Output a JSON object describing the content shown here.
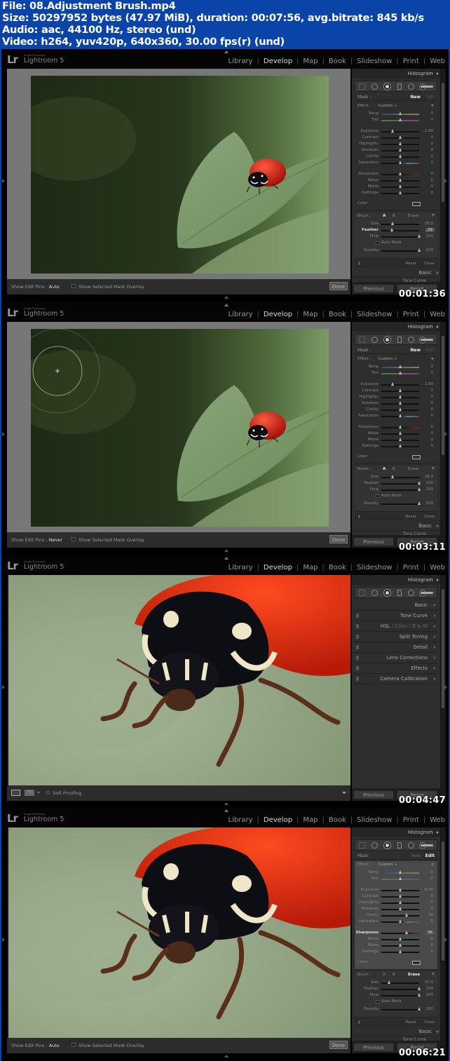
{
  "file_info": {
    "line1": "File: 08.Adjustment Brush.mp4",
    "line2": "Size: 50297952 bytes (47.97 MiB), duration: 00:07:56, avg.bitrate: 845 kb/s",
    "line3": "Audio: aac, 44100 Hz, stereo (und)",
    "line4": "Video: h264, yuv420p, 640x360, 30.00 fps(r) (und)"
  },
  "app": {
    "logo": "Lr",
    "adobe_label": "Adobe Photoshop",
    "name": "Lightroom 5",
    "modules": [
      "Library",
      "Develop",
      "Map",
      "Book",
      "Slideshow",
      "Print",
      "Web"
    ],
    "active_module": "Develop"
  },
  "panel_labels": {
    "histogram": "Histogram",
    "mask": "Mask :",
    "new": "New",
    "edit": "Edit",
    "effect": "Effect :",
    "effect_value": "Custom ÷",
    "color": "Color",
    "brush": "Brush :",
    "brush_a": "A",
    "brush_b": "B",
    "erase": "Erase",
    "auto_mask": "Auto Mask",
    "reset": "Reset",
    "close": "Close",
    "basic": "Basic",
    "tone_curve": "Tone Curve",
    "previous": "Previous",
    "reset_button": "Reset",
    "done": "Done",
    "show_edit_pins": "Show Edit Pins :",
    "show_mask_overlay": "Show Selected Mask Overlay",
    "soft_proofing": "Soft Proofing"
  },
  "frames": [
    {
      "timestamp": "00:01:36",
      "show_edit_pins": "Auto",
      "mask_state": "new",
      "sliders": [
        {
          "label": "Temp",
          "value": "0",
          "pos": 0.5,
          "track": "temp"
        },
        {
          "label": "Tint",
          "value": "0",
          "pos": 0.5,
          "track": "tint"
        },
        {
          "label": "Exposure",
          "value": "- 1.89",
          "pos": 0.3
        },
        {
          "label": "Contrast",
          "value": "0",
          "pos": 0.5
        },
        {
          "label": "Highlights",
          "value": "0",
          "pos": 0.5
        },
        {
          "label": "Shadows",
          "value": "0",
          "pos": 0.5
        },
        {
          "label": "Clarity",
          "value": "0",
          "pos": 0.5
        },
        {
          "label": "Saturation",
          "value": "0",
          "pos": 0.5,
          "track": "sat"
        },
        {
          "label": "Sharpness",
          "value": "0",
          "pos": 0.5,
          "track": "sharp"
        },
        {
          "label": "Noise",
          "value": "0",
          "pos": 0.5
        },
        {
          "label": "Moiré",
          "value": "0",
          "pos": 0.5
        },
        {
          "label": "Defringe",
          "value": "0",
          "pos": 0.5
        }
      ],
      "brush": [
        {
          "label": "Size",
          "value": "28.0",
          "pos": 0.3
        },
        {
          "label": "Feather",
          "value": "29",
          "pos": 0.29,
          "active": true
        },
        {
          "label": "Flow",
          "value": "100",
          "pos": 1.0
        },
        {
          "label": "Density",
          "value": "100",
          "pos": 1.0
        }
      ]
    },
    {
      "timestamp": "00:03:11",
      "show_edit_pins": "Never",
      "mask_state": "new",
      "sliders": [
        {
          "label": "Temp",
          "value": "0",
          "pos": 0.5,
          "track": "temp"
        },
        {
          "label": "Tint",
          "value": "0",
          "pos": 0.5,
          "track": "tint"
        },
        {
          "label": "Exposure",
          "value": "- 1.89",
          "pos": 0.3
        },
        {
          "label": "Contrast",
          "value": "0",
          "pos": 0.5
        },
        {
          "label": "Highlights",
          "value": "0",
          "pos": 0.5
        },
        {
          "label": "Shadows",
          "value": "0",
          "pos": 0.5
        },
        {
          "label": "Clarity",
          "value": "0",
          "pos": 0.5
        },
        {
          "label": "Saturation",
          "value": "0",
          "pos": 0.5,
          "track": "sat"
        },
        {
          "label": "Sharpness",
          "value": "0",
          "pos": 0.5,
          "track": "sharp"
        },
        {
          "label": "Noise",
          "value": "0",
          "pos": 0.5
        },
        {
          "label": "Moiré",
          "value": "0",
          "pos": 0.5
        },
        {
          "label": "Defringe",
          "value": "0",
          "pos": 0.5
        }
      ],
      "brush": [
        {
          "label": "Size",
          "value": "28.0",
          "pos": 0.3
        },
        {
          "label": "Feather",
          "value": "100",
          "pos": 1.0
        },
        {
          "label": "Flow",
          "value": "100",
          "pos": 1.0
        },
        {
          "label": "Density",
          "value": "100",
          "pos": 1.0
        }
      ]
    },
    {
      "timestamp": "00:04:47",
      "sections": [
        {
          "label": "Basic",
          "switch": false
        },
        {
          "label": "Tone Curve",
          "switch": true
        },
        {
          "label": "HSL / Color / B & W",
          "switch": true
        },
        {
          "label": "Split Toning",
          "switch": true
        },
        {
          "label": "Detail",
          "switch": true
        },
        {
          "label": "Lens Corrections",
          "switch": true
        },
        {
          "label": "Effects",
          "switch": true
        },
        {
          "label": "Camera Calibration",
          "switch": true
        }
      ],
      "hsl_parts": [
        "HSL",
        "Color",
        "B & W"
      ]
    },
    {
      "timestamp": "00:06:21",
      "show_edit_pins": "Auto",
      "mask_state": "edit",
      "sliders": [
        {
          "label": "Temp",
          "value": "0",
          "pos": 0.5,
          "track": "temp"
        },
        {
          "label": "Tint",
          "value": "0",
          "pos": 0.5,
          "track": "tint"
        },
        {
          "label": "Exposure",
          "value": "0.00",
          "pos": 0.5
        },
        {
          "label": "Contrast",
          "value": "0",
          "pos": 0.5
        },
        {
          "label": "Highlights",
          "value": "0",
          "pos": 0.5
        },
        {
          "label": "Shadows",
          "value": "0",
          "pos": 0.5
        },
        {
          "label": "Clarity",
          "value": "34",
          "pos": 0.67
        },
        {
          "label": "Saturation",
          "value": "0",
          "pos": 0.5,
          "track": "sat"
        },
        {
          "label": "Sharpness",
          "value": "36",
          "pos": 0.68,
          "track": "sharp",
          "active": true
        },
        {
          "label": "Noise",
          "value": "0",
          "pos": 0.5
        },
        {
          "label": "Moiré",
          "value": "0",
          "pos": 0.5
        },
        {
          "label": "Defringe",
          "value": "0",
          "pos": 0.5
        }
      ],
      "brush": [
        {
          "label": "Size",
          "value": "20.0",
          "pos": 0.22
        },
        {
          "label": "Feather",
          "value": "100",
          "pos": 1.0
        },
        {
          "label": "Flow",
          "value": "100",
          "pos": 1.0
        },
        {
          "label": "Density",
          "value": "100",
          "pos": 1.0
        }
      ],
      "erase_active": true
    }
  ]
}
